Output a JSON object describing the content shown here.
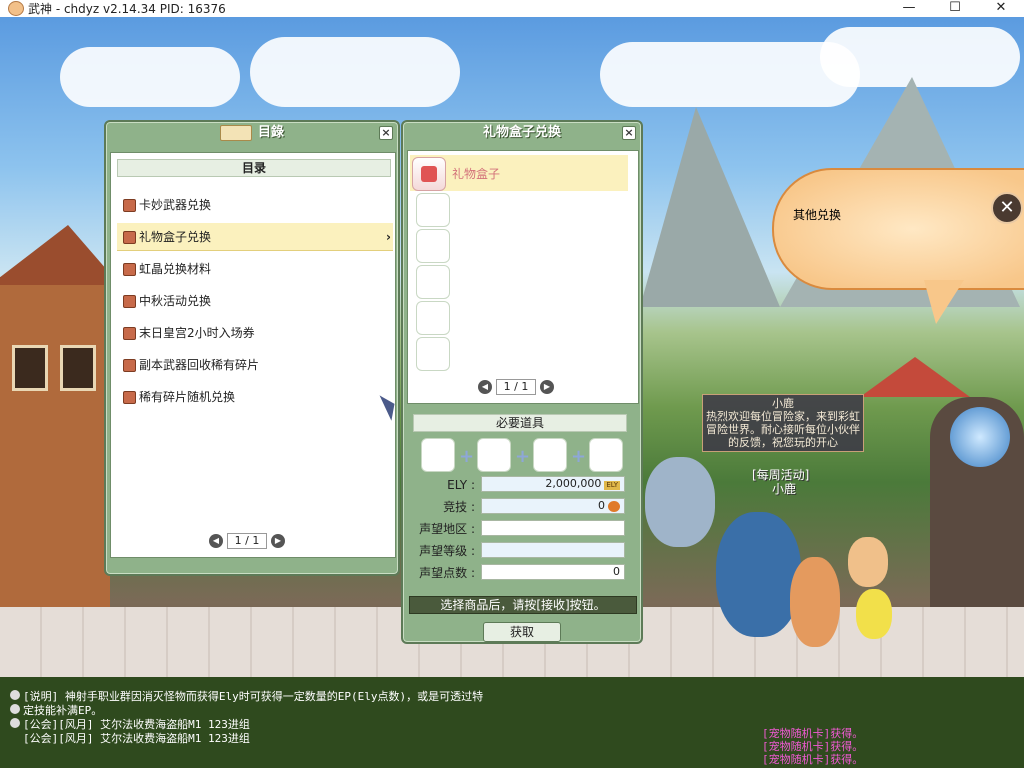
{
  "window": {
    "title": "武神 - chdyz v2.14.34    PID: 16376",
    "minimize": "—",
    "maximize": "☐",
    "close": "✕"
  },
  "catalog": {
    "title": "目錄",
    "header": "目录",
    "items": [
      {
        "label": "卡妙武器兑换"
      },
      {
        "label": "礼物盒子兑换",
        "selected": true
      },
      {
        "label": "虹晶兑换材料"
      },
      {
        "label": "中秋活动兑换"
      },
      {
        "label": "末日皇宫2小时入场券"
      },
      {
        "label": "副本武器回收稀有碎片"
      },
      {
        "label": "稀有碎片随机兑换"
      }
    ],
    "pager": "1 / 1",
    "close": "×"
  },
  "exchange": {
    "title": "礼物盒子兑换",
    "close": "×",
    "item_label": "礼物盒子",
    "pager": "1 / 1",
    "required_header": "必要道具",
    "fields": {
      "ely_label": "ELY :",
      "ely_value": "2,000,000",
      "ely_badge": "ELY",
      "arena_label": "竞技 :",
      "arena_value": "0",
      "rep_area_label": "声望地区 :",
      "rep_area_value": "",
      "rep_level_label": "声望等级 :",
      "rep_level_value": "",
      "rep_points_label": "声望点数 :",
      "rep_points_value": "0"
    },
    "message": "选择商品后，请按[接收]按钮。",
    "get_button": "获取"
  },
  "bubble": {
    "text": "其他兑换",
    "close": "✕"
  },
  "npc": {
    "sign_title": "小鹿",
    "sign_text": "热烈欢迎每位冒险家，来到彩虹冒险世界。耐心接听每位小伙伴的反馈，祝您玩的开心",
    "label_event": "[每周活动]",
    "label_name": "小鹿"
  },
  "chat": {
    "lines": [
      "[说明] 神射手职业群因消灭怪物而获得Ely时可获得一定数量的EP(Ely点数)，或是可透过特",
      "定技能补满EP。",
      "[公会][风月] 艾尔法收费海盗船M1    123进组",
      "[公会][风月] 艾尔法收费海盗船M1    123进组"
    ]
  },
  "loot": {
    "lines": [
      "[宠物随机卡]获得。",
      "[宠物随机卡]获得。",
      "[宠物随机卡]获得。"
    ]
  },
  "colors": {
    "panel": "#8fb28a",
    "selected_row": "#fbf1be",
    "bubble": "#f8c78a",
    "loot_text": "#f05ad4"
  }
}
